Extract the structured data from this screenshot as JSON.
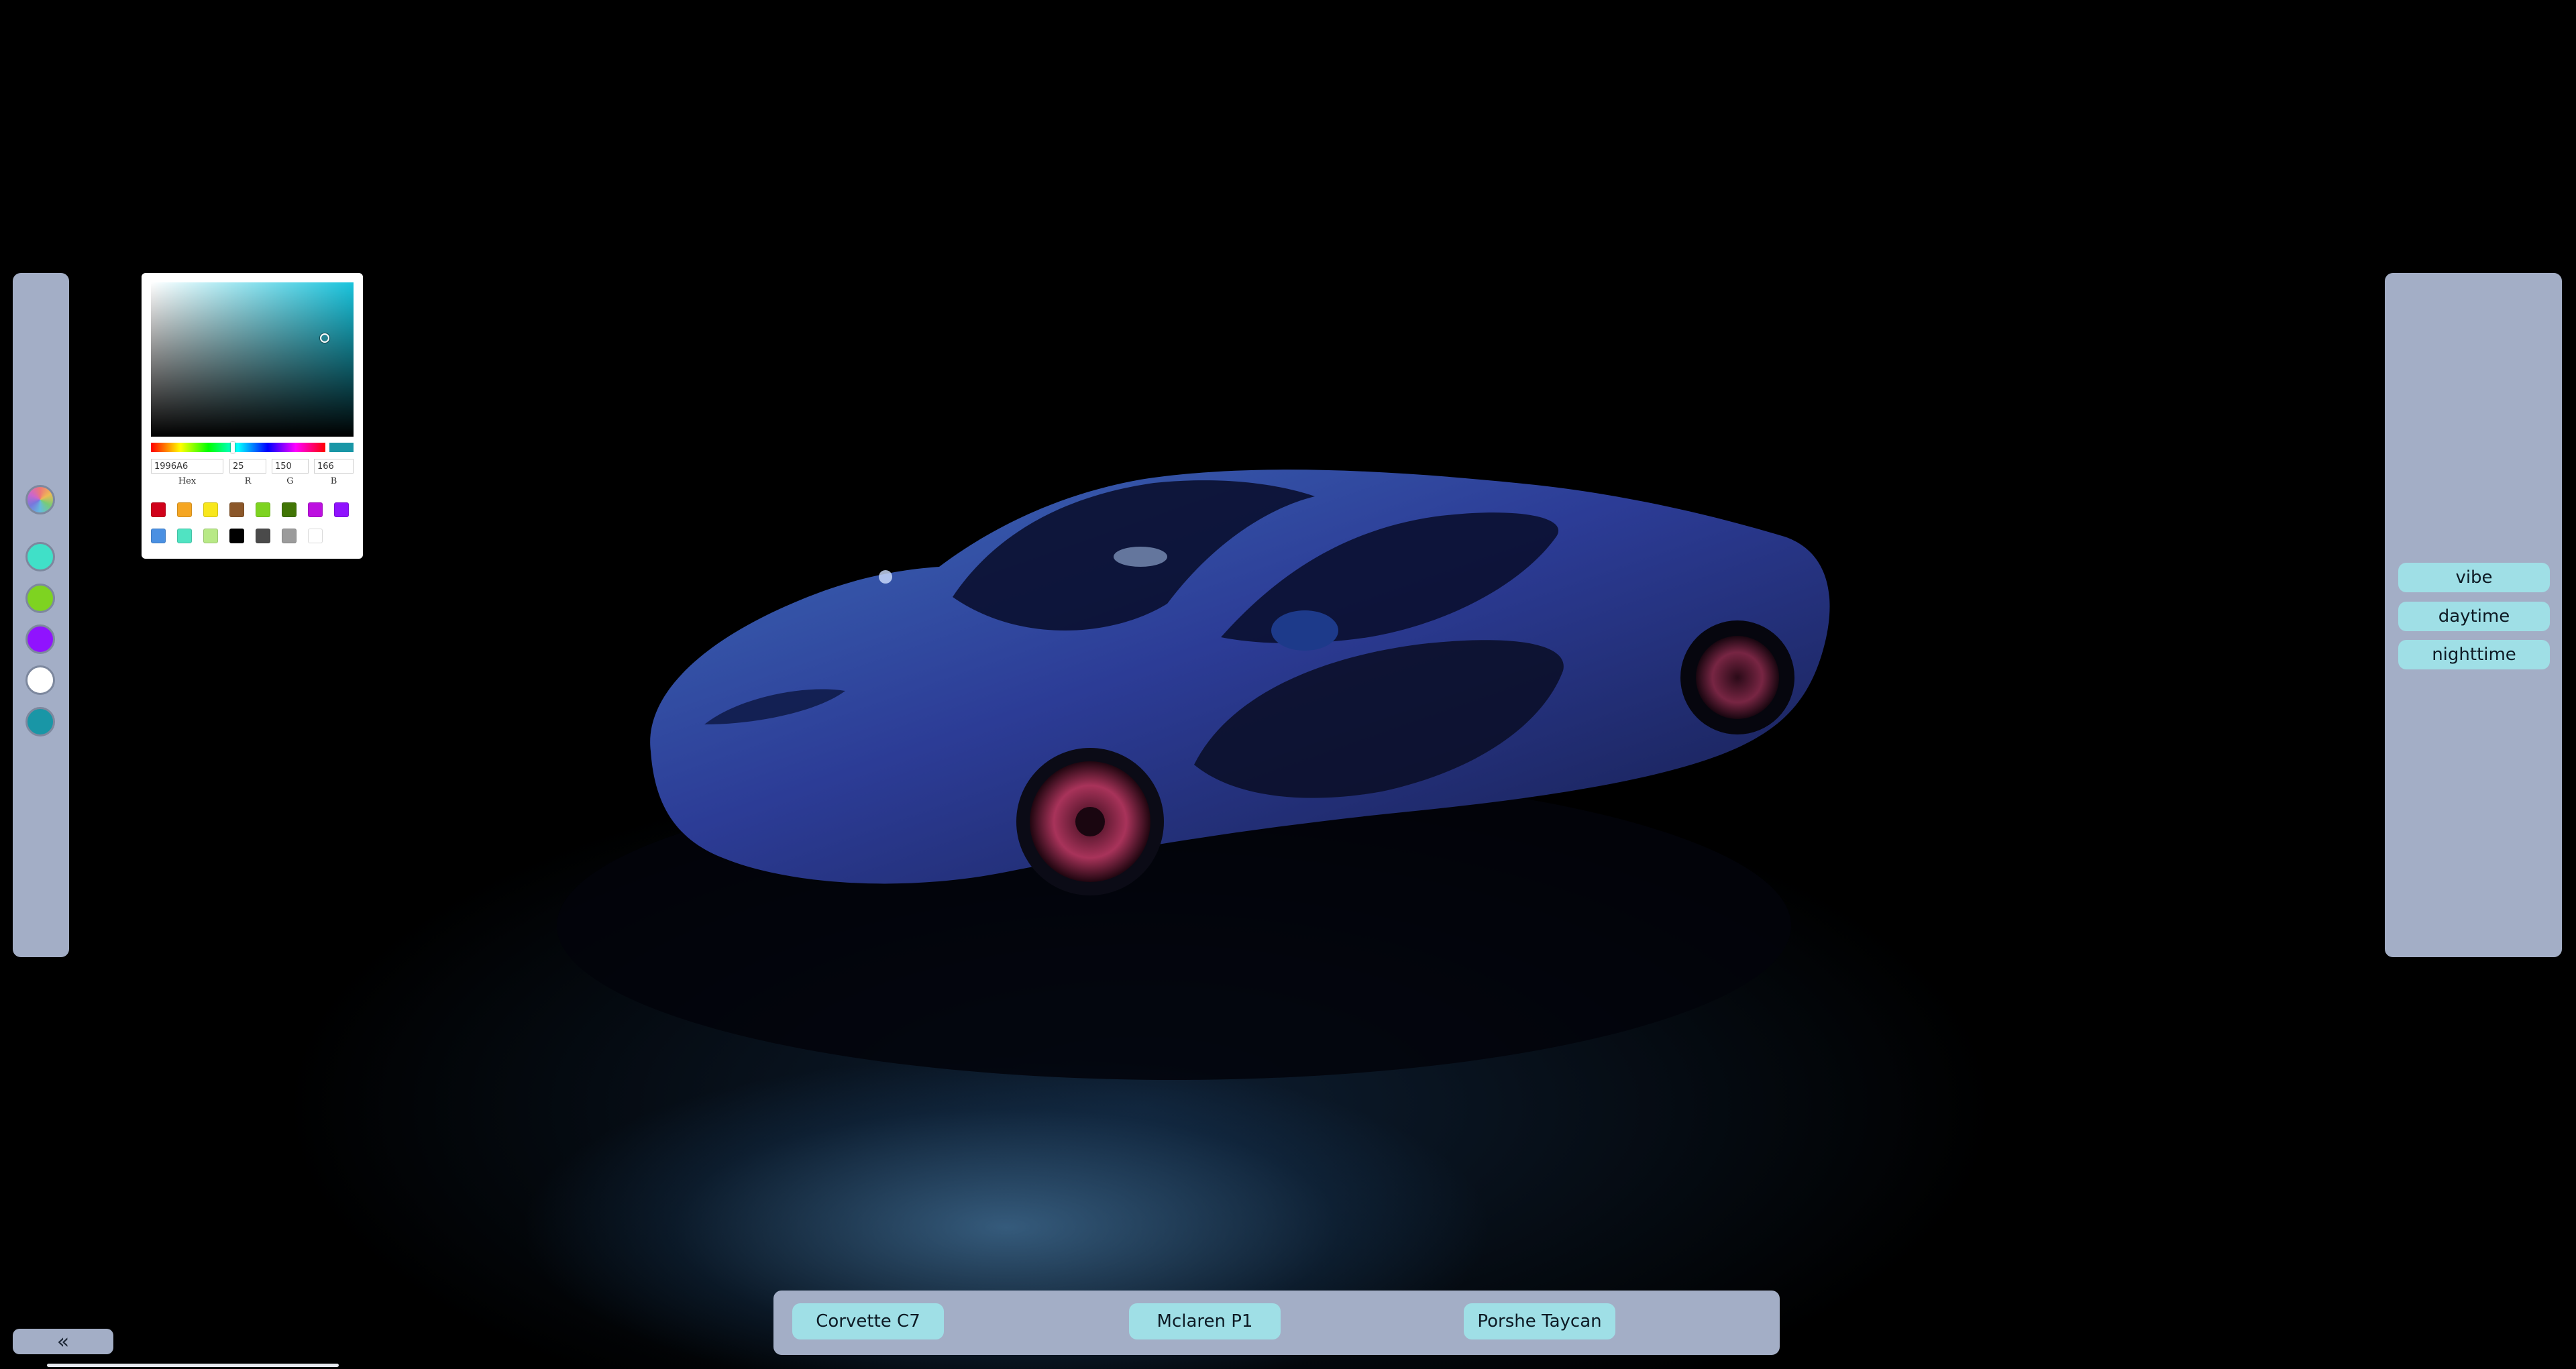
{
  "left_panel": {
    "palette_button_icon": "color-wheel-icon",
    "swatches": [
      {
        "name": "turquoise",
        "color": "#40e0c8"
      },
      {
        "name": "green",
        "color": "#7ed321"
      },
      {
        "name": "purple",
        "color": "#9013fe"
      },
      {
        "name": "white",
        "color": "#ffffff"
      },
      {
        "name": "teal",
        "color": "#1996a6"
      }
    ]
  },
  "color_picker": {
    "hex": "1996A6",
    "r": "25",
    "g": "150",
    "b": "166",
    "labels": {
      "hex": "Hex",
      "r": "R",
      "g": "G",
      "b": "B"
    },
    "current_color": "#1996a6",
    "presets": [
      "#d0021b",
      "#f5a623",
      "#f8e71c",
      "#8b572a",
      "#7ed321",
      "#417505",
      "#bd10e0",
      "#9013fe",
      "#4a90e2",
      "#50e3c2",
      "#b8e986",
      "#000000",
      "#4a4a4a",
      "#9b9b9b",
      "#ffffff"
    ]
  },
  "right_panel": {
    "buttons": [
      "vibe",
      "daytime",
      "nighttime"
    ]
  },
  "car_bar": {
    "buttons": [
      "Corvette C7",
      "Mclaren P1",
      "Porshe Taycan"
    ]
  },
  "collapse_button": {
    "label": "«"
  },
  "colors": {
    "panel_bg": "#a3aec6",
    "button_bg": "#9fdfe6",
    "car_body": "#2e3f9a"
  }
}
